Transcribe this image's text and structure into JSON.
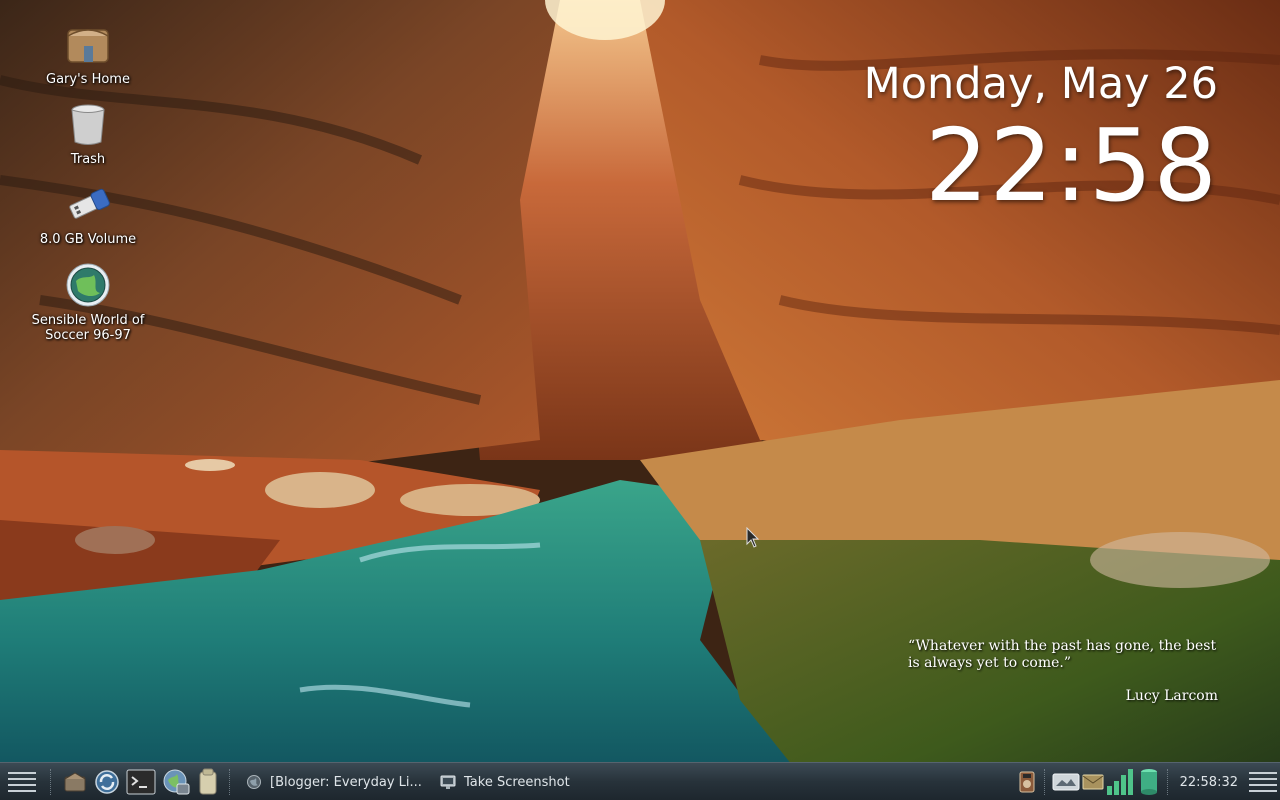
{
  "desktop": {
    "icons": [
      {
        "label": "Gary's Home",
        "icon": "home-folder-icon"
      },
      {
        "label": "Trash",
        "icon": "trash-icon"
      },
      {
        "label": "8.0 GB Volume",
        "icon": "usb-drive-icon"
      },
      {
        "label": "Sensible World of Soccer 96-97",
        "icon": "globe-disc-icon"
      }
    ]
  },
  "clock_widget": {
    "date": "Monday, May 26",
    "time": "22:58"
  },
  "quote_widget": {
    "text": "“Whatever with the past has gone, the best is always yet to come.”",
    "author": "Lucy Larcom"
  },
  "taskbar": {
    "launchers": [
      {
        "icon": "app-menu-icon"
      },
      {
        "icon": "files-icon"
      },
      {
        "icon": "update-icon"
      },
      {
        "icon": "terminal-icon"
      },
      {
        "icon": "browser-icon"
      },
      {
        "icon": "text-editor-icon"
      }
    ],
    "tasks": [
      {
        "label": "[Blogger: Everyday Li...",
        "icon": "browser-window-icon"
      },
      {
        "label": "Take Screenshot",
        "icon": "screenshot-icon"
      }
    ],
    "tray": [
      {
        "icon": "media-player-icon"
      },
      {
        "icon": "drive-icon"
      },
      {
        "icon": "mail-icon"
      },
      {
        "icon": "wifi-signal-icon"
      },
      {
        "icon": "battery-icon"
      }
    ],
    "clock": "22:58:32"
  },
  "colors": {
    "taskbar_bg": "#27323a",
    "text": "#ffffff",
    "tray_green": "#4fc38a"
  }
}
